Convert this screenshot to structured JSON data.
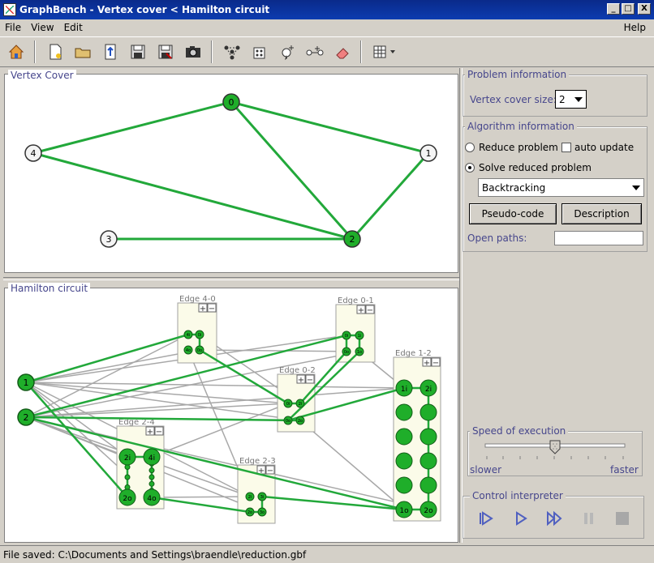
{
  "window": {
    "title": "GraphBench - Vertex cover < Hamilton circuit",
    "minimize": "_",
    "maximize": "□",
    "close": "X"
  },
  "menu": {
    "file": "File",
    "view": "View",
    "edit": "Edit",
    "help": "Help"
  },
  "toolbar": {
    "icons": [
      "home-icon",
      "new-file-icon",
      "open-folder-icon",
      "convert-icon",
      "save-icon",
      "save-as-icon",
      "camera-icon",
      "graph-layout-icon",
      "random-graph-icon",
      "add-vertex-icon",
      "add-edge-icon",
      "eraser-icon",
      "grid-icon"
    ]
  },
  "panels": {
    "vertex_cover": "Vertex Cover",
    "hamilton": "Hamilton circuit"
  },
  "vertex_cover_graph": {
    "vertices": [
      {
        "id": "0",
        "selected": true
      },
      {
        "id": "1",
        "selected": false
      },
      {
        "id": "2",
        "selected": true
      },
      {
        "id": "3",
        "selected": false
      },
      {
        "id": "4",
        "selected": false
      }
    ],
    "edges": [
      [
        "4",
        "0"
      ],
      [
        "0",
        "2"
      ],
      [
        "0",
        "1"
      ],
      [
        "4",
        "2"
      ],
      [
        "1",
        "2"
      ],
      [
        "3",
        "2"
      ]
    ]
  },
  "hamilton_graph": {
    "vertices": [
      "1",
      "2"
    ],
    "gadgets": [
      {
        "label": "Edge 4-0",
        "nodes": [
          "4i",
          "0i",
          "4o",
          "0o"
        ]
      },
      {
        "label": "Edge 0-1",
        "nodes": [
          "0i",
          "1i",
          "0o",
          "1o"
        ]
      },
      {
        "label": "Edge 0-2",
        "nodes": [
          "0i",
          "2i",
          "0o",
          "2o"
        ]
      },
      {
        "label": "Edge 1-2",
        "nodes": [
          "1i",
          "2i",
          "1o",
          "2o"
        ]
      },
      {
        "label": "Edge 2-4",
        "nodes": [
          "2i",
          "4i",
          "2o",
          "4o"
        ]
      },
      {
        "label": "Edge 2-3",
        "nodes": [
          "2i",
          "3i",
          "2o",
          "3o"
        ]
      }
    ],
    "gadget_buttons": [
      "+",
      "−"
    ]
  },
  "problem_info": {
    "legend": "Problem information",
    "cover_size_label": "Vertex cover size:",
    "cover_size_value": "2"
  },
  "algorithm_info": {
    "legend": "Algorithm information",
    "reduce_label": "Reduce problem",
    "auto_update_label": "auto update",
    "solve_label": "Solve reduced problem",
    "algorithm_value": "Backtracking",
    "pseudo_code": "Pseudo-code",
    "description": "Description",
    "open_paths_label": "Open paths:",
    "open_paths_value": ""
  },
  "speed": {
    "legend": "Speed of execution",
    "slower": "slower",
    "faster": "faster",
    "value": 0.5
  },
  "control": {
    "legend": "Control interpreter",
    "icons": [
      "step-icon",
      "play-icon",
      "fast-forward-icon",
      "pause-icon",
      "stop-icon"
    ]
  },
  "status": {
    "text": "File saved: C:\\Documents and Settings\\braendle\\reduction.gbf"
  },
  "colors": {
    "green_edge": "#22a83a",
    "node_selected": "#1fae2a",
    "gray_edge": "#a8a8a8",
    "legend": "#46468c"
  }
}
